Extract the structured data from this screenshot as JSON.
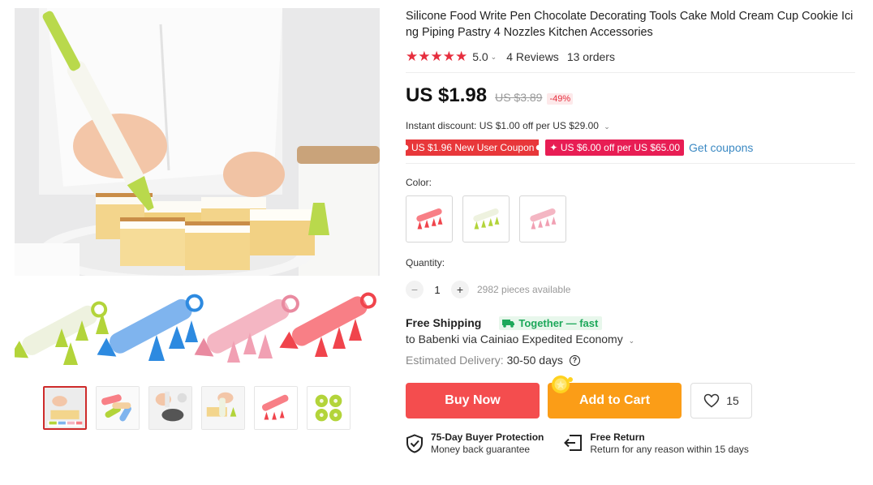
{
  "product": {
    "title": "Silicone Food Write Pen Chocolate Decorating Tools Cake Mold Cream Cup Cookie Icing Piping Pastry 4 Nozzles Kitchen Accessories",
    "rating": "5.0",
    "reviews": "4 Reviews",
    "orders": "13 orders"
  },
  "price": {
    "current": "US $1.98",
    "original": "US $3.89",
    "discount": "-49%",
    "instant_discount": "Instant discount: US $1.00 off per US $29.00"
  },
  "coupons": {
    "new_user": "US $1.96 New User Coupon",
    "store": "US $6.00 off per US $65.00",
    "get": "Get coupons"
  },
  "color": {
    "label": "Color:",
    "options": [
      "red",
      "green",
      "pink"
    ]
  },
  "quantity": {
    "label": "Quantity:",
    "value": "1",
    "available": "2982 pieces available"
  },
  "shipping": {
    "title": "Free Shipping",
    "badge": "Together — fast",
    "route": "to Babenki via Cainiao Expedited Economy",
    "delivery_label": "Estimated Delivery:",
    "delivery_days": "30-50 days"
  },
  "actions": {
    "buy": "Buy Now",
    "cart": "Add to Cart",
    "wish_count": "15"
  },
  "guarantees": [
    {
      "title": "75-Day Buyer Protection",
      "sub": "Money back guarantee"
    },
    {
      "title": "Free Return",
      "sub": "Return for any reason within 15 days"
    }
  ],
  "colors": {
    "accent_red": "#e62e3e",
    "buy_button": "#f44d4e",
    "cart_button": "#fb9d17",
    "link_blue": "#3b89c3",
    "fast_green": "#1da85a"
  }
}
